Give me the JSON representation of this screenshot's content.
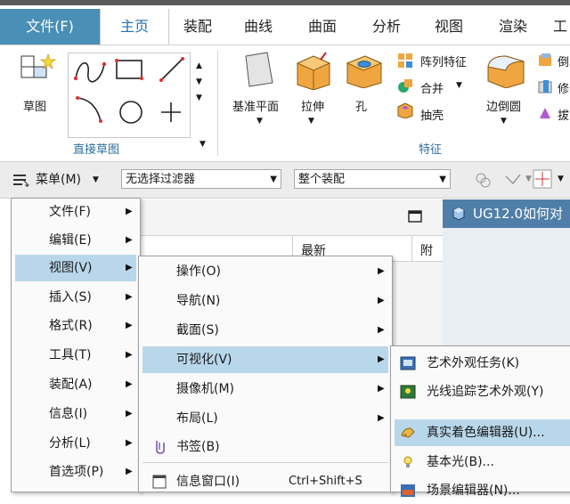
{
  "tabs": [
    "文件(F)",
    "主页",
    "装配",
    "曲线",
    "曲面",
    "分析",
    "视图",
    "渲染",
    "工"
  ],
  "ribbon": {
    "sketch_label": "草图",
    "group_direct_sketch": "直接草图",
    "datum_plane": "基准平面",
    "extrude": "拉伸",
    "hole": "孔",
    "pattern_feature": "阵列特征",
    "unite": "合并",
    "shell": "抽壳",
    "edge_blend": "边倒圆",
    "trim_partial_1": "倒",
    "trim_partial_2": "修",
    "trim_partial_3": "拔",
    "group_features": "特征"
  },
  "toolbar": {
    "menu_button": "菜单(M)",
    "filter_value": "无选择过滤器",
    "assembly_value": "整个装配"
  },
  "background": {
    "window_title": "UG12.0如何对",
    "column_latest": "最新",
    "column_partial": "附"
  },
  "main_menu": [
    {
      "label": "文件(F)"
    },
    {
      "label": "编辑(E)"
    },
    {
      "label": "视图(V)"
    },
    {
      "label": "插入(S)"
    },
    {
      "label": "格式(R)"
    },
    {
      "label": "工具(T)"
    },
    {
      "label": "装配(A)"
    },
    {
      "label": "信息(I)"
    },
    {
      "label": "分析(L)"
    },
    {
      "label": "首选项(P)"
    }
  ],
  "view_menu": [
    {
      "label": "操作(O)"
    },
    {
      "label": "导航(N)"
    },
    {
      "label": "截面(S)"
    },
    {
      "label": "可视化(V)"
    },
    {
      "label": "摄像机(M)"
    },
    {
      "label": "布局(L)"
    },
    {
      "label": "书签(B)"
    },
    {
      "label": "信息窗口(I)",
      "shortcut": "Ctrl+Shift+S"
    }
  ],
  "visual_menu": [
    {
      "label": "艺术外观任务(K)"
    },
    {
      "label": "光线追踪艺术外观(Y)"
    },
    {
      "label": "真实着色编辑器(U)..."
    },
    {
      "label": "基本光(B)..."
    },
    {
      "label": "场景编辑器(N)..."
    }
  ],
  "colors": {
    "accent": "#4a8fb5",
    "selection": "#b9d7ea",
    "title_bar": "#4f7fa8"
  }
}
